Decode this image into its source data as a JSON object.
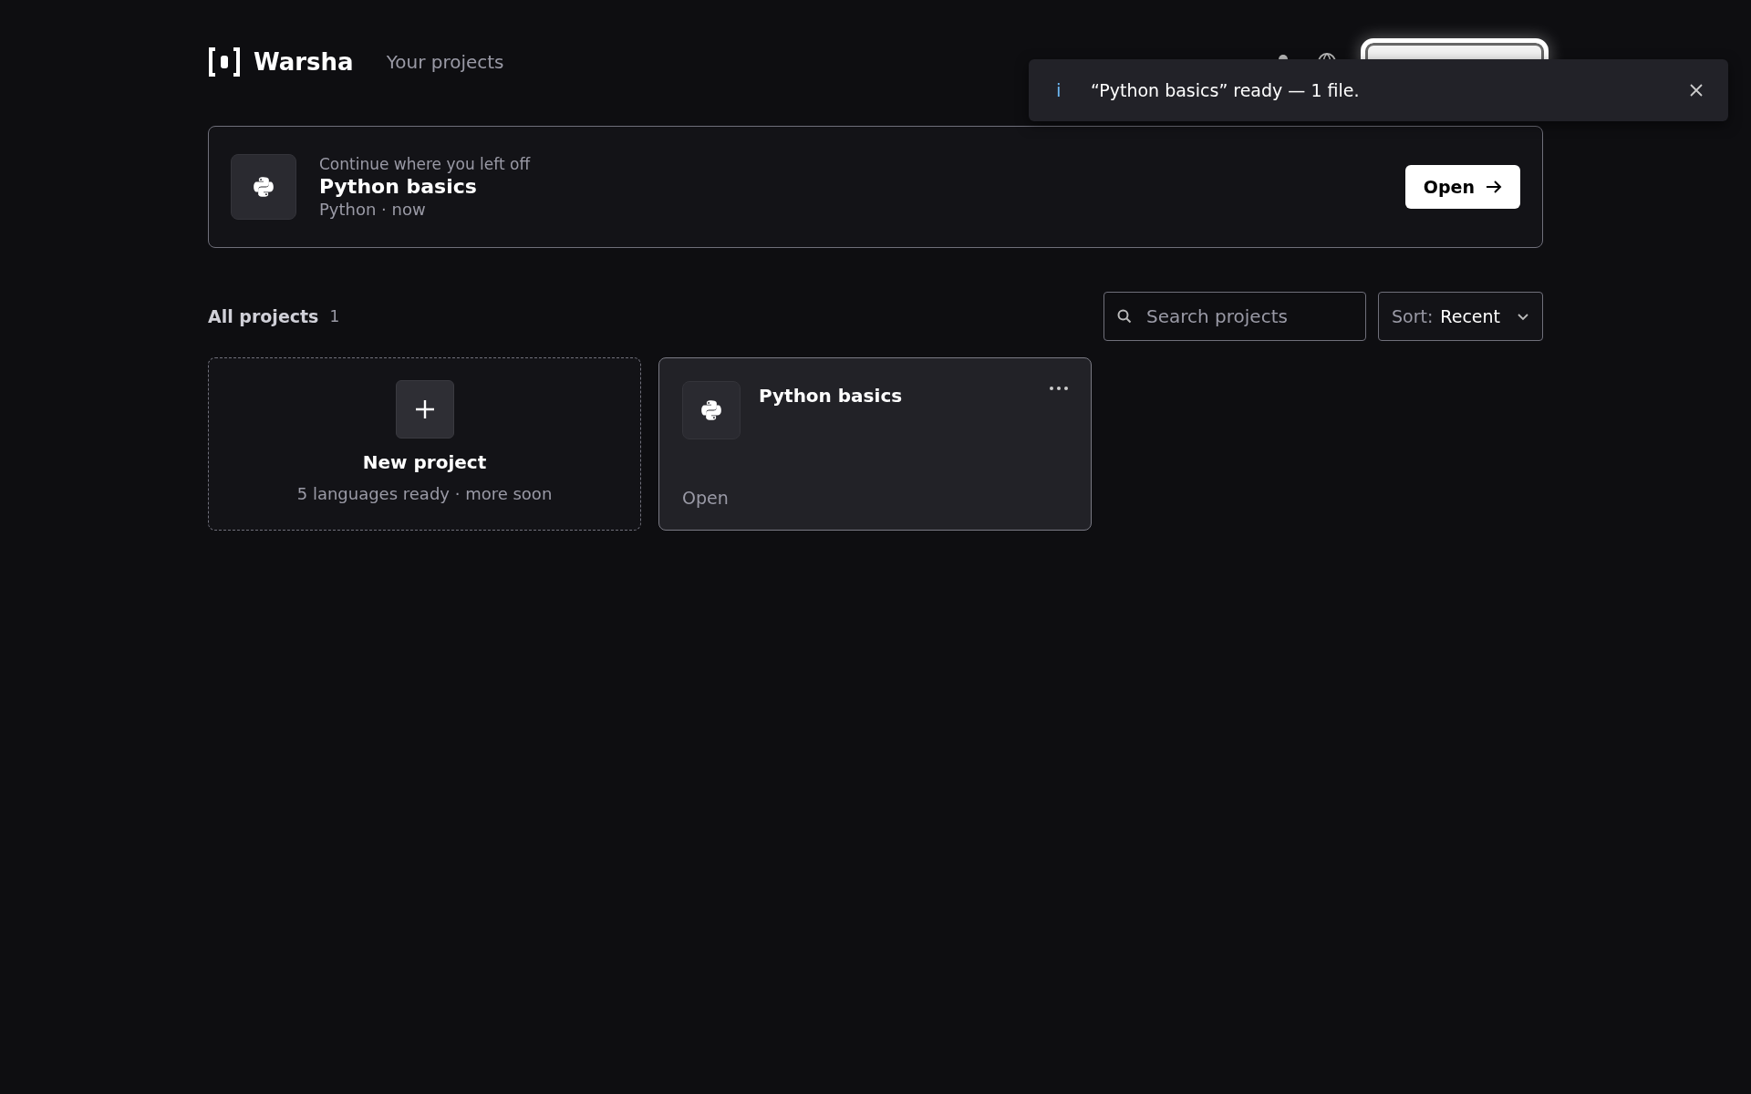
{
  "header": {
    "brand": "Warsha",
    "nav_link": "Your projects"
  },
  "toast": {
    "icon": "i",
    "message": "“Python basics” ready — 1 file."
  },
  "continue_card": {
    "eyebrow": "Continue where you left off",
    "title": "Python basics",
    "meta": "Python · now",
    "button": "Open"
  },
  "projects": {
    "heading": "All projects",
    "count": "1",
    "search": {
      "placeholder": "Search projects"
    },
    "sort": {
      "label": "Sort:",
      "value": "Recent"
    },
    "cards": [
      {
        "kind": "new",
        "title": "New project",
        "subtitle": "5 languages ready · more soon"
      },
      {
        "kind": "project",
        "title": "Python basics",
        "action": "Open"
      }
    ]
  }
}
